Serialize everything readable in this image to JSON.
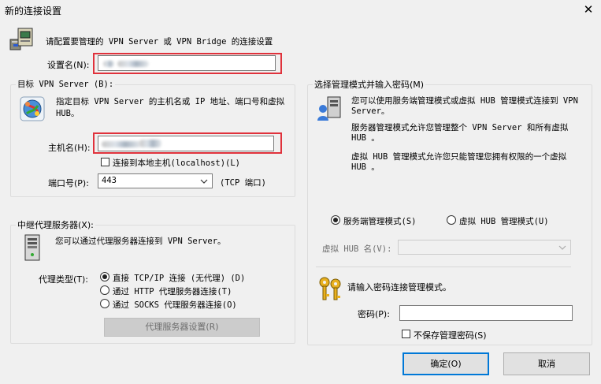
{
  "window": {
    "title": "新的连接设置",
    "close_glyph": "✕"
  },
  "intro": {
    "text": "请配置要管理的 VPN Server 或 VPN Bridge 的连接设置"
  },
  "setting_name": {
    "label": "设置名(N):",
    "value": ""
  },
  "target": {
    "group_label": "目标 VPN Server (B):",
    "description": "指定目标 VPN Server 的主机名或 IP 地址、端口号和虚拟 HUB。",
    "host_label": "主机名(H):",
    "host_value": "",
    "localhost_label": "连接到本地主机(localhost)(L)",
    "localhost_checked": false,
    "port_label": "端口号(P):",
    "port_value": "443",
    "port_suffix": "(TCP 端口)"
  },
  "proxy": {
    "group_label": "中继代理服务器(X):",
    "description": "您可以通过代理服务器连接到 VPN Server。",
    "type_label": "代理类型(T):",
    "options": [
      {
        "label": "直接 TCP/IP 连接 (无代理) (D)",
        "selected": true
      },
      {
        "label": "通过 HTTP 代理服务器连接(T)",
        "selected": false
      },
      {
        "label": "通过 SOCKS 代理服务器连接(O)",
        "selected": false
      }
    ],
    "settings_button": "代理服务器设置(R)"
  },
  "admin": {
    "group_label": "选择管理模式并输入密码(M)",
    "desc1": "您可以使用服务端管理模式或虚拟 HUB 管理模式连接到 VPN Server。",
    "desc2": "服务器管理模式允许您管理整个 VPN Server 和所有虚拟 HUB 。",
    "desc3": "虚拟 HUB 管理模式允许您只能管理您拥有权限的一个虚拟 HUB 。",
    "mode_server": "服务端管理模式(S)",
    "mode_hub": "虚拟 HUB 管理模式(U)",
    "selected_mode": "server",
    "hub_name_label": "虚拟 HUB 名(V):",
    "hub_name_value": "",
    "password_prompt": "请输入密码连接管理模式。",
    "password_label": "密码(P):",
    "password_value": "",
    "no_save_label": "不保存管理密码(S)",
    "no_save_checked": false
  },
  "buttons": {
    "ok": "确定(O)",
    "cancel": "取消"
  },
  "icons": [
    "server-computer-icon",
    "network-globe-icon",
    "proxy-computer-icon",
    "users-computer-icon",
    "keys-icon",
    "chevron-down-icon",
    "close-icon"
  ]
}
